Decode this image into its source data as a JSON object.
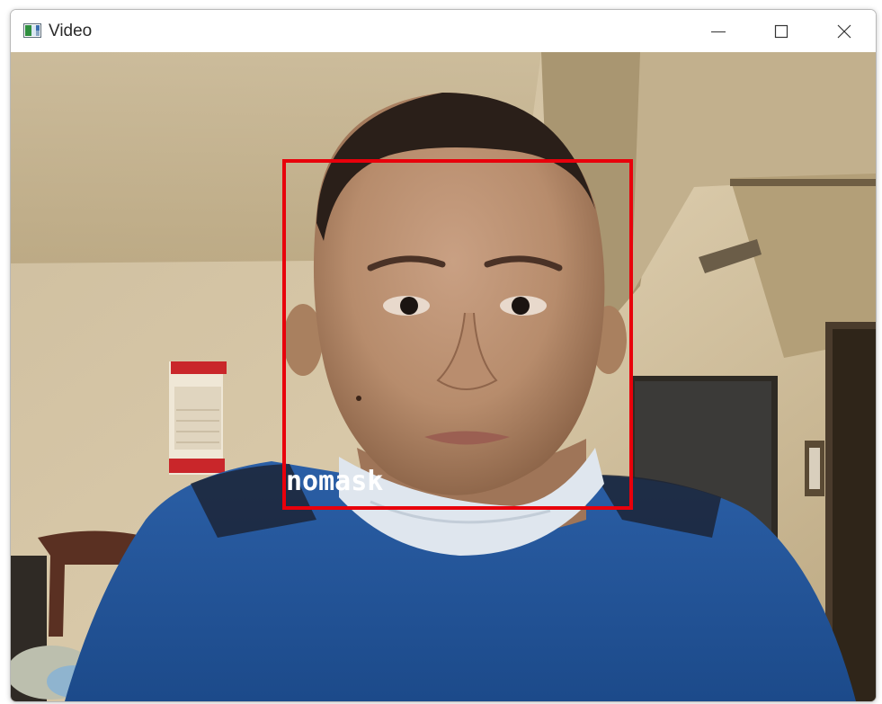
{
  "window": {
    "title": "Video",
    "icon": "app-video-icon"
  },
  "titlebar_buttons": {
    "minimize_icon": "minimize-icon",
    "maximize_icon": "maximize-icon",
    "close_icon": "close-icon"
  },
  "detection": {
    "label": "nomask",
    "box_color": "#e8000b",
    "label_color": "#ffffff"
  }
}
